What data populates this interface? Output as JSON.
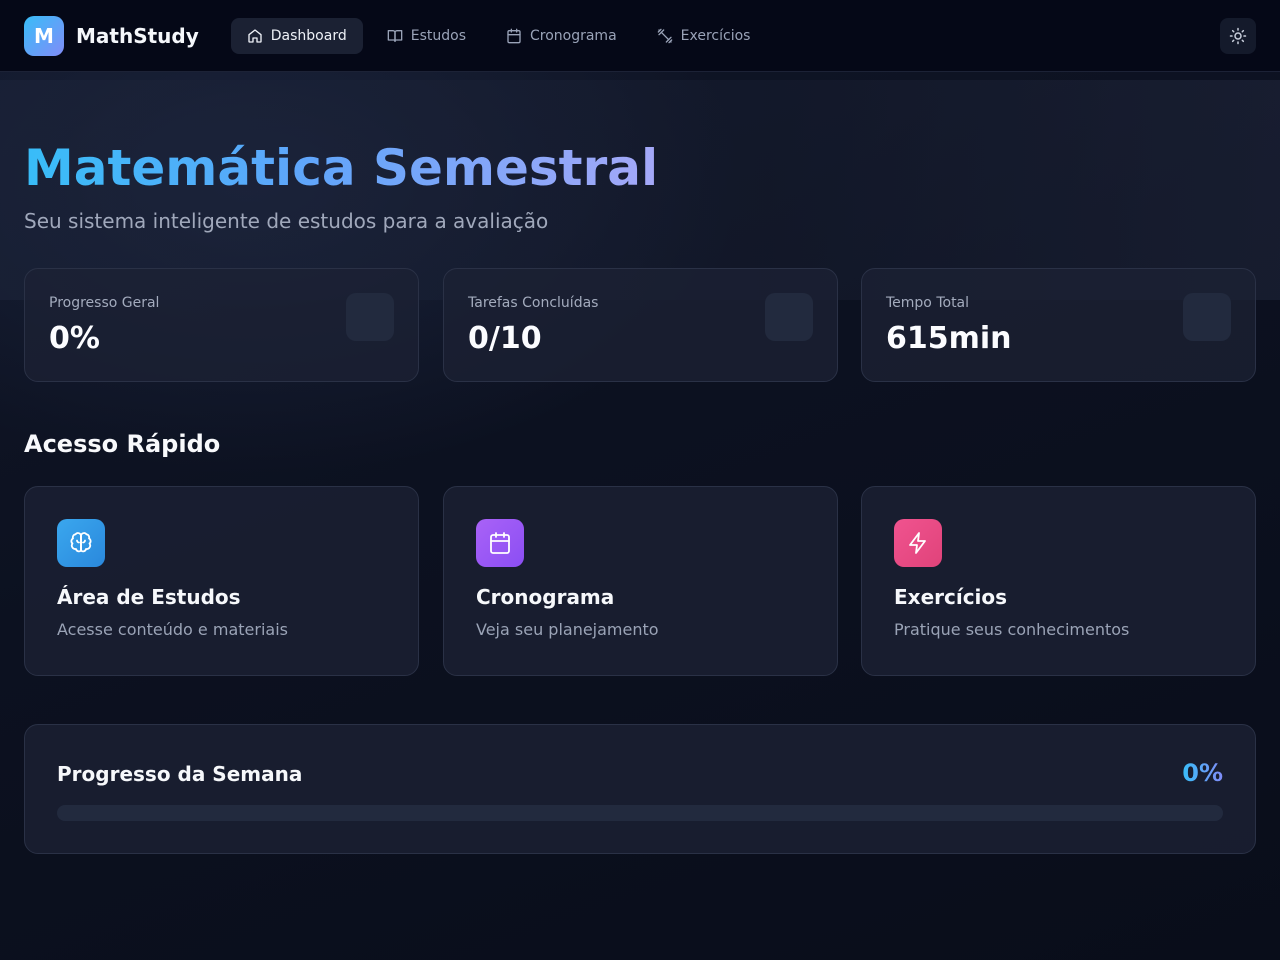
{
  "brand": {
    "logo_letter": "M",
    "name": "MathStudy"
  },
  "nav": {
    "items": [
      {
        "label": "Dashboard",
        "icon": "home-icon",
        "active": true
      },
      {
        "label": "Estudos",
        "icon": "book-icon",
        "active": false
      },
      {
        "label": "Cronograma",
        "icon": "calendar-icon",
        "active": false
      },
      {
        "label": "Exercícios",
        "icon": "dumbbell-icon",
        "active": false
      }
    ],
    "theme_toggle_icon": "sun-icon"
  },
  "hero": {
    "title": "Matemática Semestral",
    "subtitle": "Seu sistema inteligente de estudos para a avaliação"
  },
  "stats": [
    {
      "label": "Progresso Geral",
      "value": "0%"
    },
    {
      "label": "Tarefas Concluídas",
      "value": "0/10"
    },
    {
      "label": "Tempo Total",
      "value": "615min"
    }
  ],
  "quick_access": {
    "title": "Acesso Rápido",
    "cards": [
      {
        "title": "Área de Estudos",
        "desc": "Acesse conteúdo e materiais",
        "icon": "brain-icon",
        "color": "#2f9be6"
      },
      {
        "title": "Cronograma",
        "desc": "Veja seu planejamento",
        "icon": "calendar-icon",
        "color": "#9b5cf6"
      },
      {
        "title": "Exercícios",
        "desc": "Pratique seus conhecimentos",
        "icon": "zap-icon",
        "color": "#ec4f86"
      }
    ]
  },
  "week": {
    "title": "Progresso da Semana",
    "percent_label": "0%",
    "progress": 0
  },
  "colors": {
    "accent_from": "#38bdf8",
    "accent_to": "#818cf8",
    "background": "#0b0f1e"
  }
}
